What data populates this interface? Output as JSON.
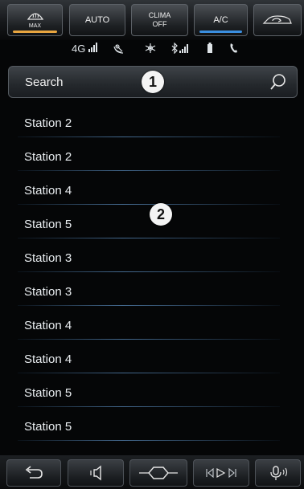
{
  "climate": {
    "max_defrost_label": "MAX",
    "auto_label": "AUTO",
    "clima_off_line1": "CLIMA",
    "clima_off_line2": "OFF",
    "ac_label": "A/C",
    "max_indicator_color": "#e9a640",
    "ac_indicator_color": "#3b8fe0"
  },
  "status": {
    "network_label": "4G"
  },
  "search": {
    "label": "Search"
  },
  "callouts": {
    "one": "1",
    "two": "2"
  },
  "stations": [
    "Station 2",
    "Station 2",
    "Station 4",
    "Station 5",
    "Station 3",
    "Station 3",
    "Station 4",
    "Station 4",
    "Station 5",
    "Station 5"
  ],
  "nav": {
    "icons": [
      "back-icon",
      "volume-icon",
      "home-icon",
      "media-skip-icon",
      "voice-icon"
    ]
  }
}
